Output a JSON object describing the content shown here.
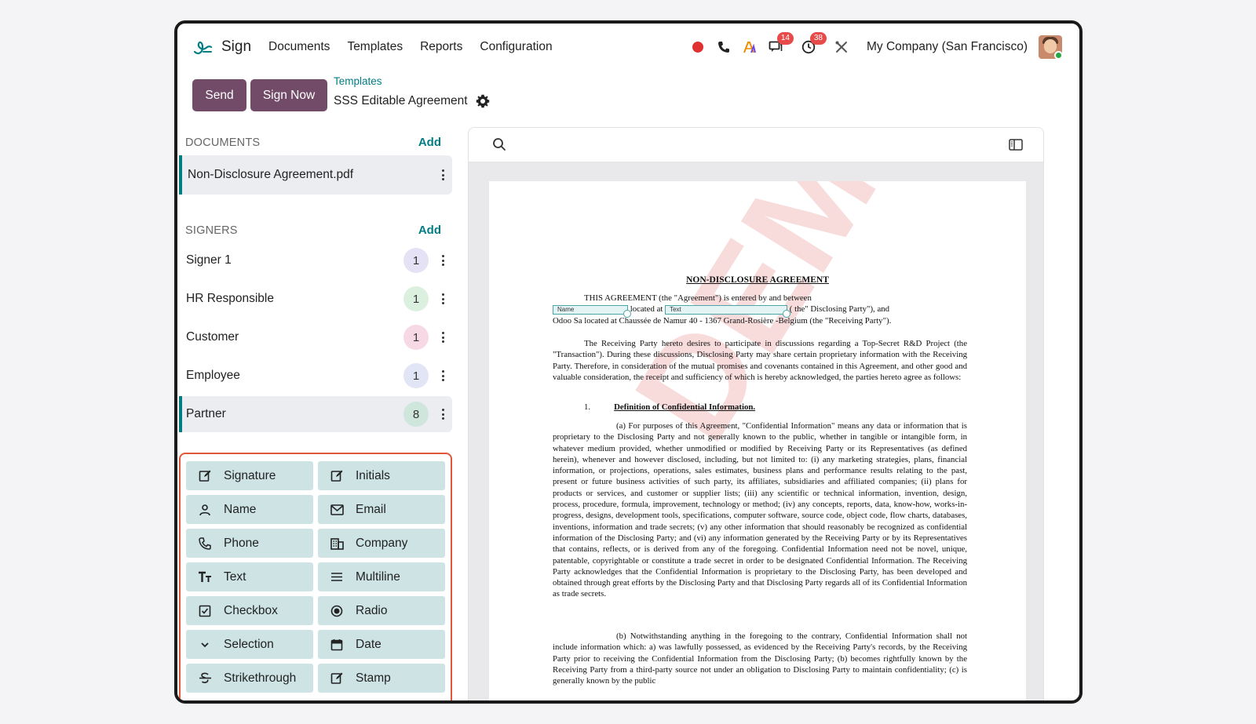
{
  "navbar": {
    "app_name": "Sign",
    "menu": [
      "Documents",
      "Templates",
      "Reports",
      "Configuration"
    ],
    "messages_badge": "14",
    "activity_badge": "38",
    "company": "My Company (San Francisco)"
  },
  "controls": {
    "send_label": "Send",
    "sign_now_label": "Sign Now",
    "breadcrumb": "Templates",
    "title": "SSS Editable Agreement"
  },
  "documents": {
    "header": "DOCUMENTS",
    "add_label": "Add",
    "items": [
      "Non-Disclosure Agreement.pdf"
    ]
  },
  "signers": {
    "header": "SIGNERS",
    "add_label": "Add",
    "items": [
      {
        "name": "Signer 1",
        "count": "1",
        "color": "#e4e2f4"
      },
      {
        "name": "HR Responsible",
        "count": "1",
        "color": "#dcf0e0"
      },
      {
        "name": "Customer",
        "count": "1",
        "color": "#f7d9e6"
      },
      {
        "name": "Employee",
        "count": "1",
        "color": "#e1e5f5"
      },
      {
        "name": "Partner",
        "count": "8",
        "color": "#cfe6dc"
      }
    ]
  },
  "fields": [
    {
      "label": "Signature",
      "icon": "edit-icon"
    },
    {
      "label": "Initials",
      "icon": "edit-icon"
    },
    {
      "label": "Name",
      "icon": "user-icon"
    },
    {
      "label": "Email",
      "icon": "envelope-icon"
    },
    {
      "label": "Phone",
      "icon": "phone-icon"
    },
    {
      "label": "Company",
      "icon": "building-icon"
    },
    {
      "label": "Text",
      "icon": "text-icon"
    },
    {
      "label": "Multiline",
      "icon": "lines-icon"
    },
    {
      "label": "Checkbox",
      "icon": "checkbox-icon"
    },
    {
      "label": "Radio",
      "icon": "radio-icon"
    },
    {
      "label": "Selection",
      "icon": "chevron-down-icon"
    },
    {
      "label": "Date",
      "icon": "calendar-icon"
    },
    {
      "label": "Strikethrough",
      "icon": "strikethrough-icon"
    },
    {
      "label": "Stamp",
      "icon": "edit-icon"
    }
  ],
  "document": {
    "title": "NON-DISCLOSURE AGREEMENT",
    "intro_1": "THIS AGREEMENT (the \"Agreement\") is entered by and between",
    "field_name": "Name",
    "located_at": "located at",
    "field_text": "Text",
    "disclosing": "( the\" Disclosing Party\"), and",
    "intro_3": "Odoo Sa located at Chaussée de Namur 40 - 1367 Grand-Rosière -Belgium (the \"Receiving Party\").",
    "para_1": "The Receiving Party hereto desires to participate in discussions regarding a Top-Secret R&D Project (the \"Transaction\"). During these discussions, Disclosing Party may share certain proprietary information with the Receiving Party. Therefore, in consideration of the mutual promises and covenants contained in this Agreement, and other good and valuable consideration, the receipt and sufficiency of which is hereby acknowledged, the parties hereto agree as follows:",
    "section_1": "1.",
    "section_1_title": "Definition of Confidential Information.",
    "para_a": "(a) For purposes of this Agreement, \"Confidential Information\" means any data or information that is proprietary to the Disclosing Party and not generally known to the public, whether in tangible or intangible form, in whatever medium provided, whether unmodified or modified by Receiving Party or its Representatives (as defined herein), whenever and however disclosed, including, but not limited to: (i) any marketing strategies, plans, financial information, or projections, operations, sales estimates, business plans and performance results relating to the past, present or future business activities of such party, its affiliates, subsidiaries and affiliated companies; (ii) plans for products or services, and customer or supplier lists; (iii) any scientific or technical information, invention, design, process, procedure, formula, improvement, technology or method; (iv) any concepts, reports, data, know-how, works-in-progress, designs, development tools, specifications, computer software, source code, object code, flow charts, databases, inventions, information and trade secrets; (v) any other information that should reasonably be recognized as confidential information of the Disclosing Party; and (vi) any information generated by the Receiving Party or by its Representatives that contains, reflects, or is derived from any of the foregoing. Confidential Information need not be novel, unique, patentable, copyrightable or constitute a trade secret in order to be designated Confidential Information. The Receiving Party acknowledges that the Confidential Information is proprietary to the Disclosing Party, has been developed and obtained through great efforts by the Disclosing Party and that Disclosing Party regards all of its Confidential Information as trade secrets.",
    "para_b": "(b) Notwithstanding anything in the foregoing to the contrary, Confidential Information shall not include information which: a) was lawfully possessed, as evidenced by the Receiving Party's records, by the Receiving Party prior to receiving the Confidential Information from the Disclosing Party; (b) becomes rightfully known by the Receiving Party from a third-party source not under an obligation to Disclosing Party to maintain confidentiality; (c) is generally known by the public",
    "watermark": "DEMO"
  }
}
